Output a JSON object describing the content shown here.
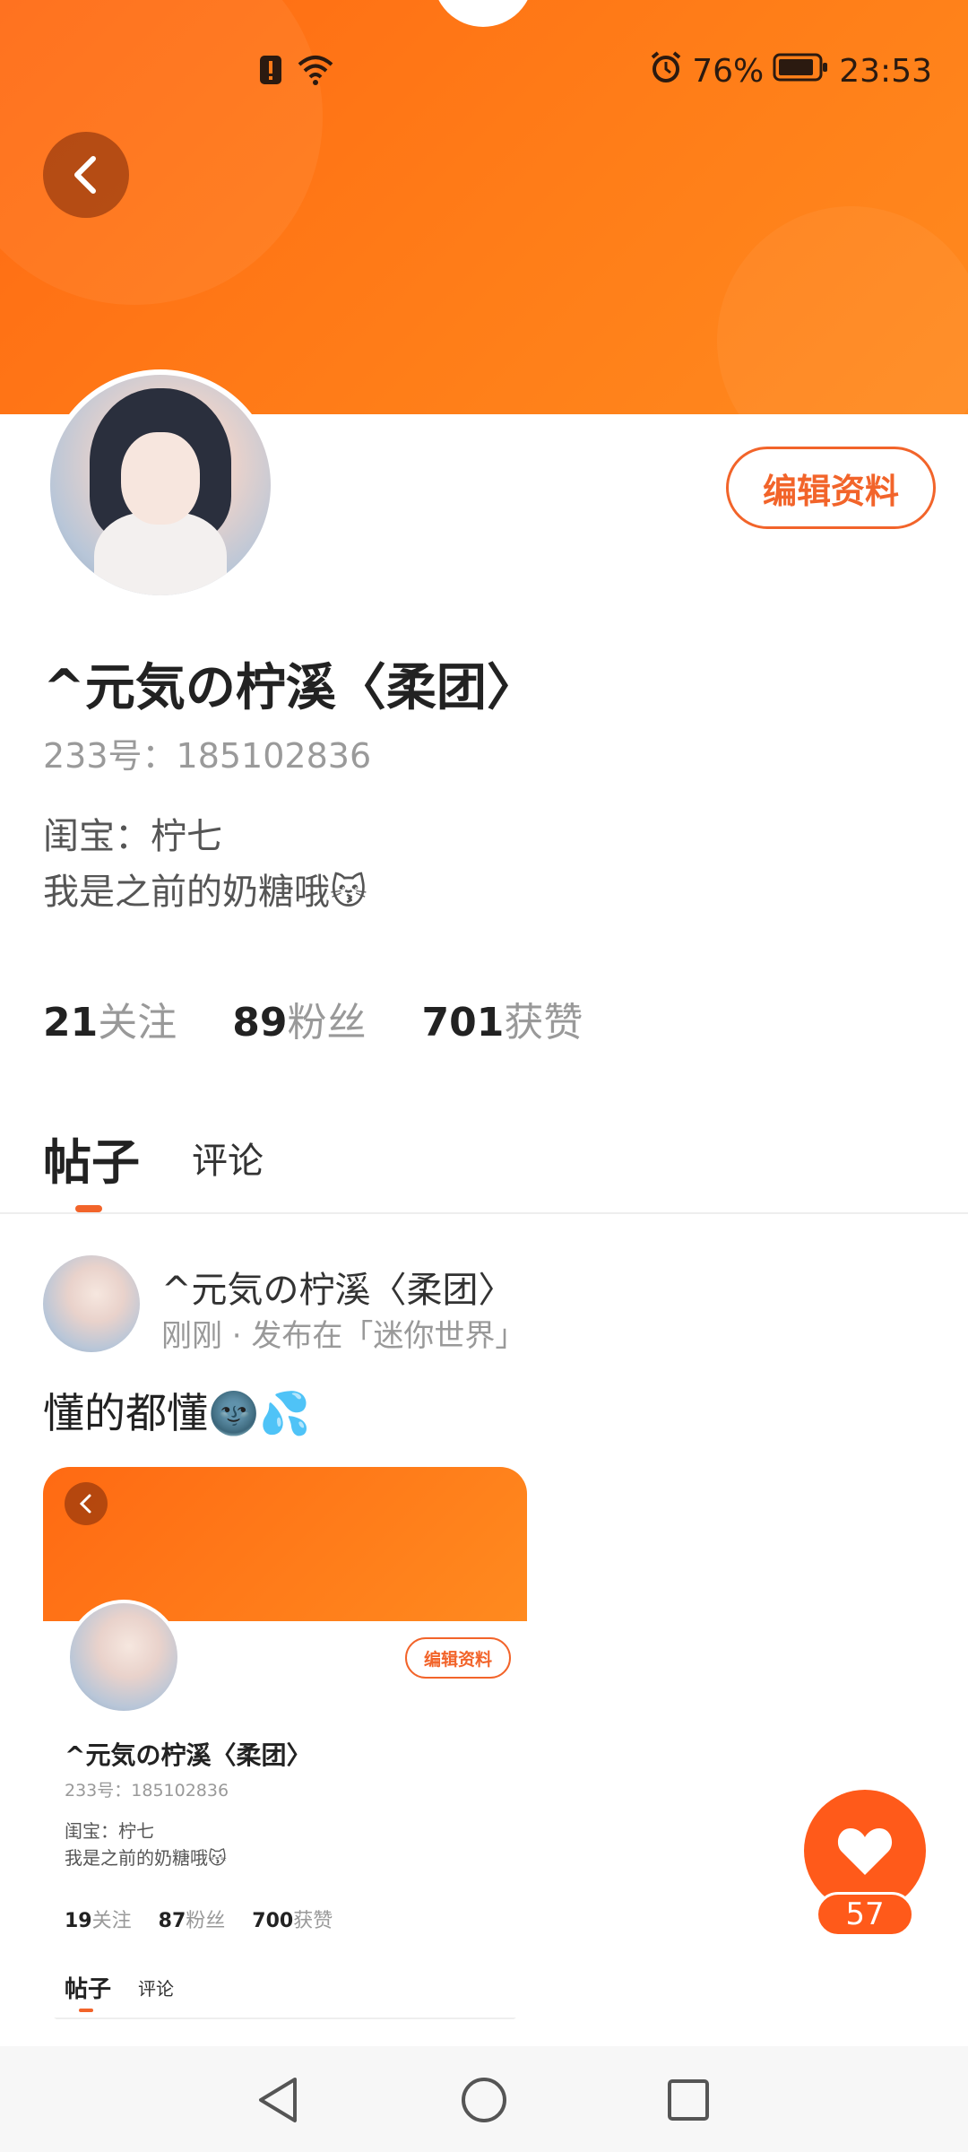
{
  "status_bar": {
    "battery_percent": "76%",
    "time": "23:53"
  },
  "profile": {
    "edit_button": "编辑资料",
    "username": "^元気の柠溪〈柔团〉",
    "uid": "233号：185102836",
    "bio_line1": "闺宝：柠七",
    "bio_line2": "我是之前的奶糖哦😽",
    "stats": [
      {
        "num": "21",
        "label": "关注"
      },
      {
        "num": "89",
        "label": "粉丝"
      },
      {
        "num": "701",
        "label": "获赞"
      }
    ]
  },
  "tabs": {
    "posts": "帖子",
    "comments": "评论"
  },
  "post": {
    "author": "^元気の柠溪〈柔团〉",
    "meta": "刚刚 · 发布在「迷你世界」",
    "text": "懂的都懂🌚💦"
  },
  "thumbnail": {
    "edit_button": "编辑资料",
    "username": "^元気の柠溪〈柔团〉",
    "uid": "233号：185102836",
    "bio_line1": "闺宝：柠七",
    "bio_line2": "我是之前的奶糖哦😽",
    "stats": [
      {
        "num": "19",
        "label": "关注"
      },
      {
        "num": "87",
        "label": "粉丝"
      },
      {
        "num": "700",
        "label": "获赞"
      }
    ],
    "tab_posts": "帖子",
    "tab_comments": "评论"
  },
  "like": {
    "count": "57"
  },
  "colors": {
    "accent": "#f2642a",
    "banner_start": "#ff6a13",
    "banner_end": "#ff8a1f",
    "like_button": "#ff5a1a"
  }
}
